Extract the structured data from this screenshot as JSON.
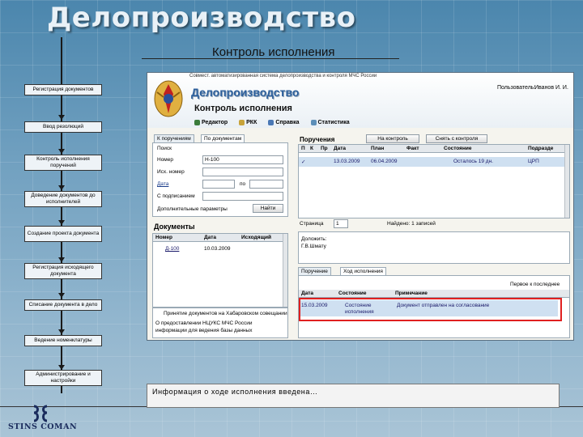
{
  "slide": {
    "title": "Делопроизводство",
    "subtitle": "Контроль исполнения"
  },
  "flow": [
    "Регистрация документов",
    "Ввод резолюций",
    "Контроль исполнения поручений",
    "Доведение документов до исполнителей",
    "Создание проекта документа",
    "Регистрация исходящего документа",
    "Списание документа в дело",
    "Ведение номенклатуры",
    "Администрирование и настройки"
  ],
  "company": {
    "logo_text": "STINS COMAN"
  },
  "app": {
    "header_top": "Совмест. автоматизированная система делопроизводства и контроля МЧС России",
    "title": "Делопроизводство",
    "subtitle": "Контроль исполнения",
    "user_label": "Пользователь:",
    "user_name": "Иванов И. И.",
    "nav": [
      "Редактор",
      "РКК",
      "Справка",
      "Статистика"
    ],
    "left_tabs": [
      "К поручениям",
      "По документам"
    ],
    "search": {
      "group_label": "Поиск",
      "fields": [
        {
          "label": "Номер",
          "value": "Н-100"
        },
        {
          "label": "Исх. номер",
          "value": ""
        },
        {
          "label": "Дата",
          "value": ""
        },
        {
          "label": "С подписанием",
          "value": ""
        },
        {
          "label": "Дополнительные параметры",
          "value": ""
        }
      ],
      "po_label": "по",
      "find_button": "Найти"
    },
    "documents": {
      "label": "Документы",
      "columns": [
        "Номер",
        "Дата",
        "Исходящий"
      ],
      "rows": [
        {
          "number": "Д-100",
          "date": "10.03.2009",
          "out": ""
        }
      ]
    },
    "notice": {
      "line1": "Принятие документов на Хабаровском совещании",
      "line2": "О предоставлении НЦУКС МЧС России",
      "line3": "информации для ведения базы данных"
    },
    "orders": {
      "label": "Поручения",
      "toolbar_on_control": "На контроль",
      "toolbar_off_control": "Снять с контроля",
      "columns": [
        "П",
        "К",
        "Пр",
        "Дата",
        "План",
        "Факт",
        "Состояние",
        "Подразде"
      ],
      "rows": [
        {
          "date": "13.03.2009",
          "plan": "06.04.2009",
          "fact": "",
          "state": "Осталось 19 дн.",
          "dept": "ЦРП"
        }
      ],
      "pager_label": "Страница",
      "pager_value": "1",
      "found": "Найдено: 1 записей",
      "executor_label": "Доложить:",
      "executor_name": "Г.В.Шмату"
    },
    "bottom_tabs": [
      "Поручение",
      "Ход исполнения"
    ],
    "history": {
      "checkbox_label": "Первое к последнее",
      "columns": [
        "Дата",
        "Состояние",
        "Примечание"
      ],
      "rows": [
        {
          "date": "15.03.2009",
          "state": "Состояние исполнения",
          "note": "Документ отправлен на согласование"
        }
      ]
    }
  },
  "status_text": "Информация о ходе исполнения введена…"
}
